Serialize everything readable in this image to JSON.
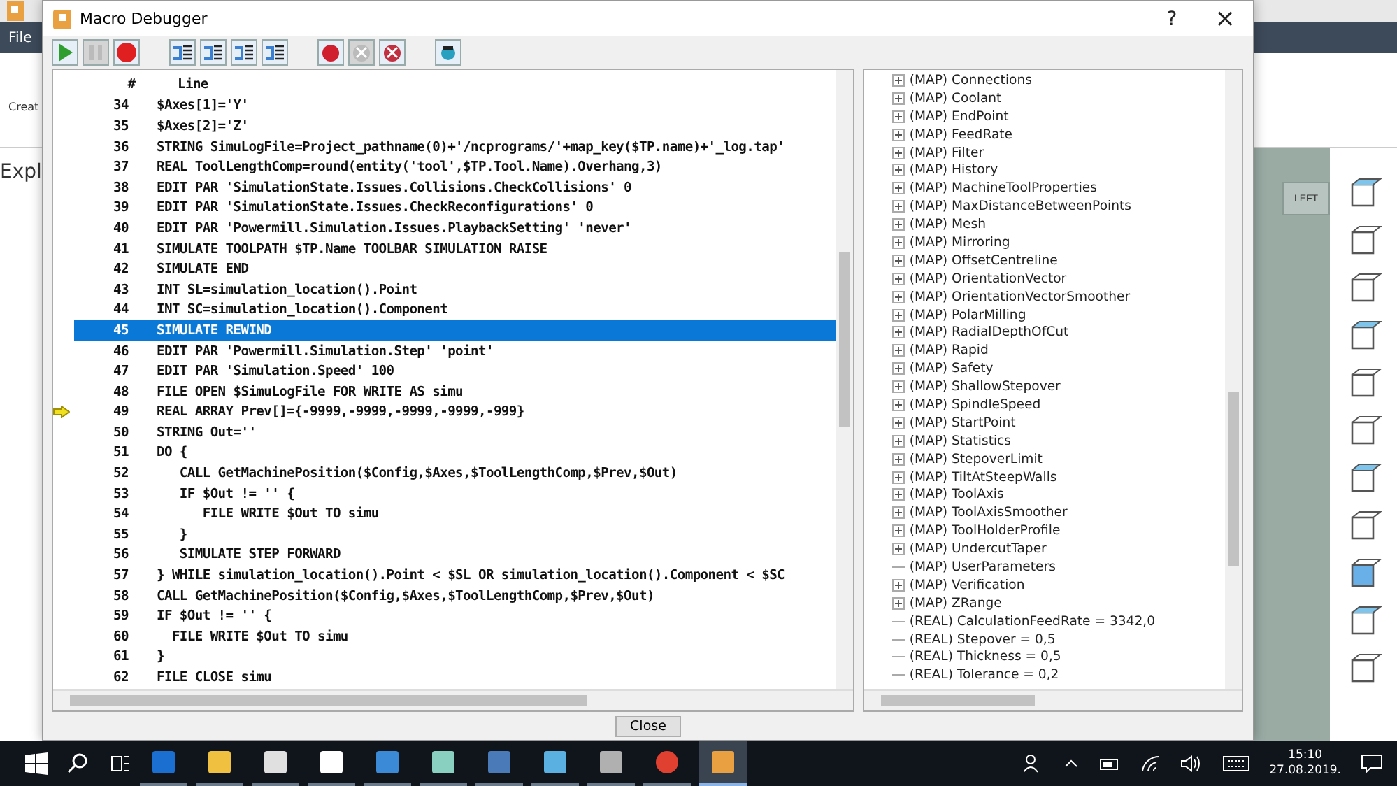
{
  "background_app": {
    "menu_tab": "File",
    "ribbon_label": "Creat",
    "explorer_title": "Expl",
    "view_button": "LEFT"
  },
  "window": {
    "title": "Macro Debugger",
    "help": "?",
    "close": "×"
  },
  "toolbar": [
    {
      "kind": "run",
      "disabled": false
    },
    {
      "kind": "pause",
      "disabled": true
    },
    {
      "kind": "stop",
      "disabled": false
    },
    {
      "kind": "step-into",
      "disabled": false
    },
    {
      "kind": "step-over",
      "disabled": false
    },
    {
      "kind": "step-out",
      "disabled": false
    },
    {
      "kind": "run-to",
      "disabled": false
    },
    {
      "kind": "breakpoint",
      "disabled": false
    },
    {
      "kind": "clear-breakpoint",
      "disabled": true
    },
    {
      "kind": "clear-all",
      "disabled": false
    },
    {
      "kind": "watch",
      "disabled": false
    }
  ],
  "code": {
    "columns": [
      "#",
      "Line"
    ],
    "rows": [
      {
        "number": "34",
        "text": "$Axes[1]='Y'",
        "selected": false,
        "current": false
      },
      {
        "number": "35",
        "text": "$Axes[2]='Z'",
        "selected": false,
        "current": false
      },
      {
        "number": "36",
        "text": "STRING SimuLogFile=Project_pathname(0)+'/ncprograms/'+map_key($TP.name)+'_log.tap'",
        "selected": false,
        "current": false
      },
      {
        "number": "37",
        "text": "REAL ToolLengthComp=round(entity('tool',$TP.Tool.Name).Overhang,3)",
        "selected": false,
        "current": false
      },
      {
        "number": "38",
        "text": "EDIT PAR 'SimulationState.Issues.Collisions.CheckCollisions' 0",
        "selected": false,
        "current": false
      },
      {
        "number": "39",
        "text": "EDIT PAR 'SimulationState.Issues.CheckReconfigurations' 0",
        "selected": false,
        "current": false
      },
      {
        "number": "40",
        "text": "EDIT PAR 'Powermill.Simulation.Issues.PlaybackSetting' 'never'",
        "selected": false,
        "current": false
      },
      {
        "number": "41",
        "text": "SIMULATE TOOLPATH $TP.Name TOOLBAR SIMULATION RAISE",
        "selected": false,
        "current": false
      },
      {
        "number": "42",
        "text": "SIMULATE END",
        "selected": false,
        "current": false
      },
      {
        "number": "43",
        "text": "INT SL=simulation_location().Point",
        "selected": false,
        "current": false
      },
      {
        "number": "44",
        "text": "INT SC=simulation_location().Component",
        "selected": false,
        "current": false
      },
      {
        "number": "45",
        "text": "SIMULATE REWIND",
        "selected": true,
        "current": false
      },
      {
        "number": "46",
        "text": "EDIT PAR 'Powermill.Simulation.Step' 'point'",
        "selected": false,
        "current": false
      },
      {
        "number": "47",
        "text": "EDIT PAR 'Simulation.Speed' 100",
        "selected": false,
        "current": false
      },
      {
        "number": "48",
        "text": "FILE OPEN $SimuLogFile FOR WRITE AS simu",
        "selected": false,
        "current": false
      },
      {
        "number": "49",
        "text": "REAL ARRAY Prev[]={-9999,-9999,-9999,-9999,-999}",
        "selected": false,
        "current": true
      },
      {
        "number": "50",
        "text": "STRING Out=''",
        "selected": false,
        "current": false
      },
      {
        "number": "51",
        "text": "DO {",
        "selected": false,
        "current": false
      },
      {
        "number": "52",
        "text": "   CALL GetMachinePosition($Config,$Axes,$ToolLengthComp,$Prev,$Out)",
        "selected": false,
        "current": false
      },
      {
        "number": "53",
        "text": "   IF $Out != '' {",
        "selected": false,
        "current": false
      },
      {
        "number": "54",
        "text": "      FILE WRITE $Out TO simu",
        "selected": false,
        "current": false
      },
      {
        "number": "55",
        "text": "   }",
        "selected": false,
        "current": false
      },
      {
        "number": "56",
        "text": "   SIMULATE STEP FORWARD",
        "selected": false,
        "current": false
      },
      {
        "number": "57",
        "text": "} WHILE simulation_location().Point < $SL OR simulation_location().Component < $SC",
        "selected": false,
        "current": false
      },
      {
        "number": "58",
        "text": "CALL GetMachinePosition($Config,$Axes,$ToolLengthComp,$Prev,$Out)",
        "selected": false,
        "current": false
      },
      {
        "number": "59",
        "text": "IF $Out != '' {",
        "selected": false,
        "current": false
      },
      {
        "number": "60",
        "text": "  FILE WRITE $Out TO simu",
        "selected": false,
        "current": false
      },
      {
        "number": "61",
        "text": "}",
        "selected": false,
        "current": false
      },
      {
        "number": "62",
        "text": "FILE CLOSE simu",
        "selected": false,
        "current": false
      }
    ]
  },
  "variables": [
    {
      "label": "(MAP) Connections",
      "expandable": true
    },
    {
      "label": "(MAP) Coolant",
      "expandable": true
    },
    {
      "label": "(MAP) EndPoint",
      "expandable": true
    },
    {
      "label": "(MAP) FeedRate",
      "expandable": true
    },
    {
      "label": "(MAP) Filter",
      "expandable": true
    },
    {
      "label": "(MAP) History",
      "expandable": true
    },
    {
      "label": "(MAP) MachineToolProperties",
      "expandable": true
    },
    {
      "label": "(MAP) MaxDistanceBetweenPoints",
      "expandable": true
    },
    {
      "label": "(MAP) Mesh",
      "expandable": true
    },
    {
      "label": "(MAP) Mirroring",
      "expandable": true
    },
    {
      "label": "(MAP) OffsetCentreline",
      "expandable": true
    },
    {
      "label": "(MAP) OrientationVector",
      "expandable": true
    },
    {
      "label": "(MAP) OrientationVectorSmoother",
      "expandable": true
    },
    {
      "label": "(MAP) PolarMilling",
      "expandable": true
    },
    {
      "label": "(MAP) RadialDepthOfCut",
      "expandable": true
    },
    {
      "label": "(MAP) Rapid",
      "expandable": true
    },
    {
      "label": "(MAP) Safety",
      "expandable": true
    },
    {
      "label": "(MAP) ShallowStepover",
      "expandable": true
    },
    {
      "label": "(MAP) SpindleSpeed",
      "expandable": true
    },
    {
      "label": "(MAP) StartPoint",
      "expandable": true
    },
    {
      "label": "(MAP) Statistics",
      "expandable": true
    },
    {
      "label": "(MAP) StepoverLimit",
      "expandable": true
    },
    {
      "label": "(MAP) TiltAtSteepWalls",
      "expandable": true
    },
    {
      "label": "(MAP) ToolAxis",
      "expandable": true
    },
    {
      "label": "(MAP) ToolAxisSmoother",
      "expandable": true
    },
    {
      "label": "(MAP) ToolHolderProfile",
      "expandable": true
    },
    {
      "label": "(MAP) UndercutTaper",
      "expandable": true
    },
    {
      "label": "(MAP) UserParameters",
      "expandable": false
    },
    {
      "label": "(MAP) Verification",
      "expandable": true
    },
    {
      "label": "(MAP) ZRange",
      "expandable": true
    },
    {
      "label": "(REAL) CalculationFeedRate = 3342,0",
      "expandable": false
    },
    {
      "label": "(REAL) Stepover = 0,5",
      "expandable": false
    },
    {
      "label": "(REAL) Thickness = 0,5",
      "expandable": false
    },
    {
      "label": "(REAL) Tolerance = 0,2",
      "expandable": false
    }
  ],
  "close_button": "Close",
  "taskbar": {
    "apps": [
      {
        "kind": "edge",
        "selected": false
      },
      {
        "kind": "folder",
        "selected": false
      },
      {
        "kind": "store",
        "selected": false
      },
      {
        "kind": "mail",
        "selected": false
      },
      {
        "kind": "app",
        "selected": false
      },
      {
        "kind": "app2",
        "selected": false
      },
      {
        "kind": "app3",
        "selected": false
      },
      {
        "kind": "app4",
        "selected": false
      },
      {
        "kind": "app5",
        "selected": false
      },
      {
        "kind": "chrome",
        "selected": false
      },
      {
        "kind": "p",
        "selected": true
      }
    ],
    "time": "15:10",
    "date": "27.08.2019."
  }
}
